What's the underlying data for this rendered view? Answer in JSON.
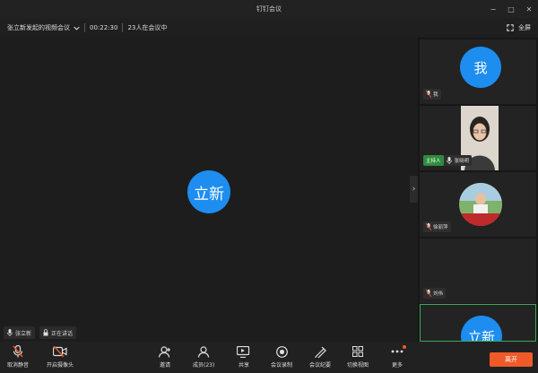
{
  "window": {
    "title": "钉钉会议",
    "minimize": "−",
    "maximize": "□",
    "close": "✕"
  },
  "info": {
    "meeting_name": "张立新发起的视频会议",
    "elapsed": "00:22:30",
    "participants_text": "23人在会议中",
    "fullscreen_label": "全屏"
  },
  "stage": {
    "speaker_avatar": "立新",
    "tags": [
      {
        "label": "张立新"
      },
      {
        "label": "正在讲话"
      }
    ],
    "collapse_glyph": "›"
  },
  "side": {
    "tiles": [
      {
        "avatar": "我",
        "name": "我"
      },
      {
        "name": "张晓明",
        "host": "主持人"
      },
      {
        "name": "徐丽萍"
      },
      {
        "name": "刘伟"
      },
      {
        "avatar": "立新"
      }
    ]
  },
  "toolbar": {
    "items": [
      {
        "label": "取消静音"
      },
      {
        "label": "开启摄像头"
      },
      {
        "label": "邀请"
      },
      {
        "label": "成员(23)"
      },
      {
        "label": "共享"
      },
      {
        "label": "会议录制"
      },
      {
        "label": "会议纪要"
      },
      {
        "label": "切换视图"
      },
      {
        "label": "更多"
      }
    ],
    "leave_label": "离开"
  },
  "colors": {
    "accent": "#1d8df0",
    "leave": "#f05a28",
    "host": "#2e8b3e",
    "active_border": "#3aaa5a"
  },
  "icons": [
    "mic-muted-icon",
    "camera-off-icon",
    "invite-icon",
    "members-icon",
    "share-icon",
    "record-icon",
    "minutes-icon",
    "grid-icon",
    "more-icon",
    "lock-icon",
    "chevron-down-icon",
    "fullscreen-icon"
  ]
}
